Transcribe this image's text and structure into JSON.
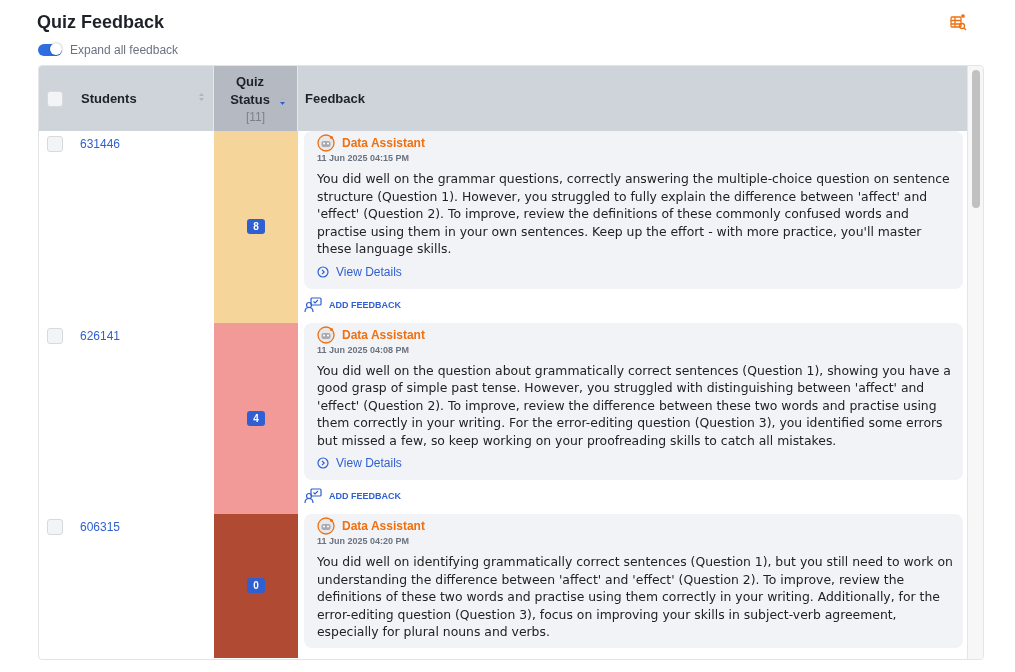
{
  "page": {
    "title": "Quiz Feedback"
  },
  "expand_toggle": {
    "label": "Expand all feedback",
    "on": true
  },
  "table": {
    "columns": [
      {
        "label": "Students",
        "sorted": false
      },
      {
        "label": "Quiz Status",
        "count": "[11]",
        "sorted": true
      },
      {
        "label": "Feedback"
      }
    ],
    "select_all": {
      "checked": false
    },
    "rows": [
      {
        "checked": false,
        "student": "631446",
        "score": "8",
        "color": "#f5d59a",
        "feedback": {
          "author": "Data Assistant",
          "time": "11 Jun 2025 04:15 PM",
          "text": "You did well on the grammar questions, correctly answering the multiple-choice question on sentence structure (Question 1). However, you struggled to fully explain the difference between 'affect' and 'effect' (Question 2). To improve, review the definitions of these commonly confused words and practise using them in your own sentences. Keep up the effort - with more practice, you'll master these language skills.",
          "link": "View Details"
        },
        "add_feedback": "ADD FEEDBACK"
      },
      {
        "checked": false,
        "student": "626141",
        "score": "4",
        "color": "#f29a98",
        "feedback": {
          "author": "Data Assistant",
          "time": "11 Jun 2025 04:08 PM",
          "text": "You did well on the question about grammatically correct sentences (Question 1), showing you have a good grasp of simple past tense. However, you struggled with distinguishing between 'affect' and 'effect' (Question 2). To improve, review the difference between these two words and practise using them correctly in your writing. For the error-editing question (Question 3), you identified some errors but missed a few, so keep working on your proofreading skills to catch all mistakes.",
          "link": "View Details"
        },
        "add_feedback": "ADD FEEDBACK"
      },
      {
        "checked": false,
        "student": "606315",
        "score": "0",
        "color": "#b04a33",
        "feedback": {
          "author": "Data Assistant",
          "time": "11 Jun 2025 04:20 PM",
          "text": "You did well on identifying grammatically correct sentences (Question 1), but you still need to work on understanding the difference between 'affect' and 'effect' (Question 2). To improve, review the definitions of these two words and practise using them correctly in your writing. Additionally, for the error-editing question (Question 3), focus on improving your skills in subject-verb agreement, especially for plural nouns and verbs."
        }
      }
    ]
  }
}
